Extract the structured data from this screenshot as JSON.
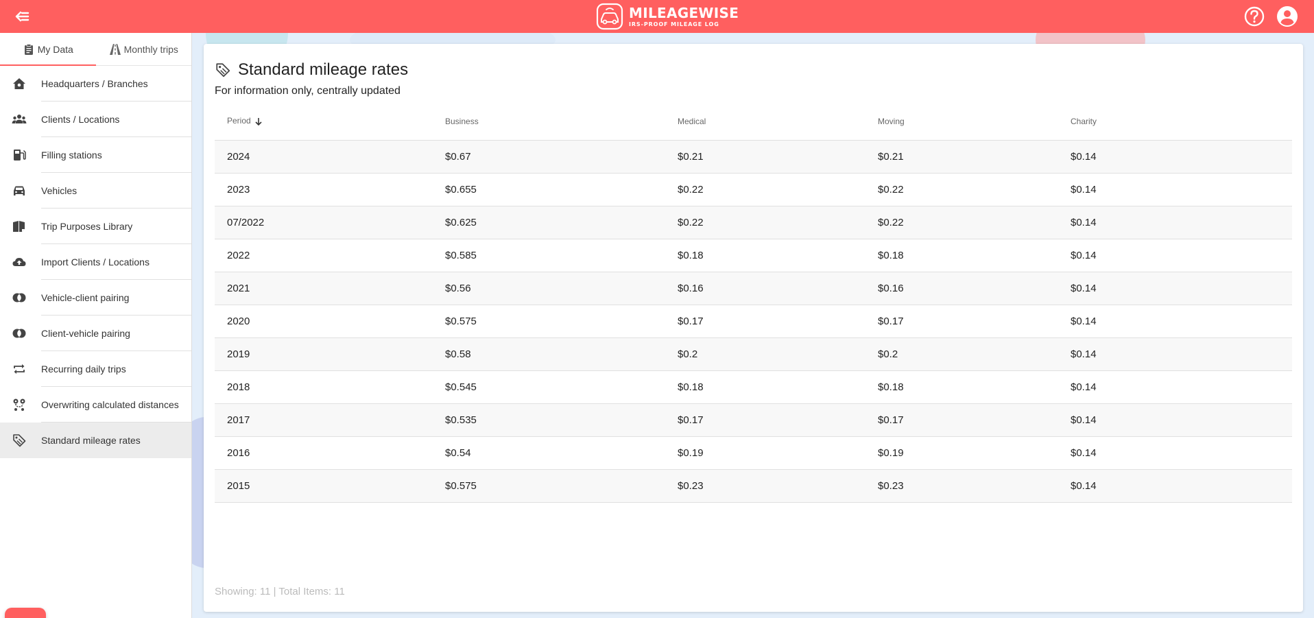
{
  "app": {
    "name": "MILEAGEWISE",
    "tagline": "IRS-PROOF MILEAGE LOG"
  },
  "colors": {
    "brand": "#ff5f5f",
    "active_item_bg": "#ececec"
  },
  "icons": {
    "back": "arrow-left-menu-icon",
    "help": "help-circle-icon",
    "account": "account-circle-icon",
    "chat": "chat-bubbles-icon"
  },
  "sidebar": {
    "tabs": [
      {
        "label": "My Data",
        "icon": "clipboard-icon",
        "active": true
      },
      {
        "label": "Monthly trips",
        "icon": "road-icon",
        "active": false
      }
    ],
    "items": [
      {
        "label": "Headquarters / Branches",
        "icon": "home-icon"
      },
      {
        "label": "Clients / Locations",
        "icon": "people-icon"
      },
      {
        "label": "Filling stations",
        "icon": "fuel-icon"
      },
      {
        "label": "Vehicles",
        "icon": "car-icon"
      },
      {
        "label": "Trip Purposes Library",
        "icon": "book-icon"
      },
      {
        "label": "Import Clients / Locations",
        "icon": "cloud-upload-icon"
      },
      {
        "label": "Vehicle-client pairing",
        "icon": "pairing-icon"
      },
      {
        "label": "Client-vehicle pairing",
        "icon": "pairing-icon"
      },
      {
        "label": "Recurring daily trips",
        "icon": "repeat-icon"
      },
      {
        "label": "Overwriting calculated distances",
        "icon": "route-icon"
      },
      {
        "label": "Standard mileage rates",
        "icon": "tag-icon",
        "active": true
      }
    ]
  },
  "main": {
    "title": "Standard mileage rates",
    "subtitle": "For information only, centrally updated",
    "table": {
      "headers": [
        "Period",
        "Business",
        "Medical",
        "Moving",
        "Charity"
      ],
      "rows": [
        [
          "2024",
          "$0.67",
          "$0.21",
          "$0.21",
          "$0.14"
        ],
        [
          "2023",
          "$0.655",
          "$0.22",
          "$0.22",
          "$0.14"
        ],
        [
          "07/2022",
          "$0.625",
          "$0.22",
          "$0.22",
          "$0.14"
        ],
        [
          "2022",
          "$0.585",
          "$0.18",
          "$0.18",
          "$0.14"
        ],
        [
          "2021",
          "$0.56",
          "$0.16",
          "$0.16",
          "$0.14"
        ],
        [
          "2020",
          "$0.575",
          "$0.17",
          "$0.17",
          "$0.14"
        ],
        [
          "2019",
          "$0.58",
          "$0.2",
          "$0.2",
          "$0.14"
        ],
        [
          "2018",
          "$0.545",
          "$0.18",
          "$0.18",
          "$0.14"
        ],
        [
          "2017",
          "$0.535",
          "$0.17",
          "$0.17",
          "$0.14"
        ],
        [
          "2016",
          "$0.54",
          "$0.19",
          "$0.19",
          "$0.14"
        ],
        [
          "2015",
          "$0.575",
          "$0.23",
          "$0.23",
          "$0.14"
        ]
      ]
    },
    "footer": "Showing: 11 | Total Items: 11"
  }
}
